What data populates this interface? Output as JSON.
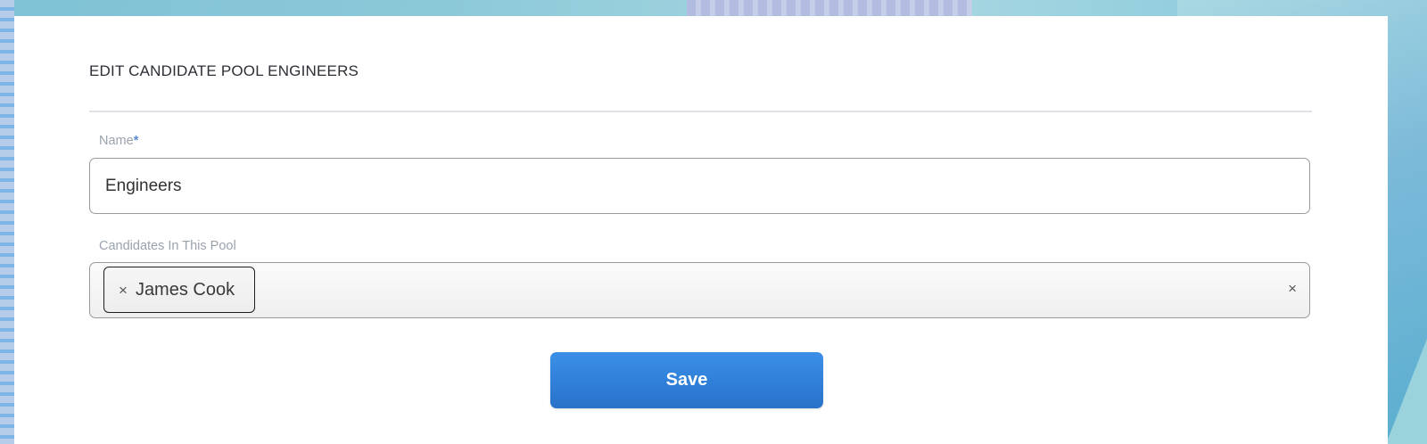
{
  "form": {
    "title": "EDIT CANDIDATE POOL ENGINEERS",
    "name_label": "Name",
    "required_marker": "*",
    "name_value": "Engineers",
    "candidates_label": "Candidates In This Pool",
    "candidates": [
      {
        "remove_glyph": "×",
        "label": "James Cook"
      }
    ],
    "clear_all_glyph": "×",
    "save_label": "Save"
  },
  "colors": {
    "accent": "#2f80dd",
    "required": "#5a8ad6",
    "label": "#9aa3ad"
  },
  "icons": {
    "chip_remove": "close-icon",
    "clear_all": "close-icon"
  }
}
